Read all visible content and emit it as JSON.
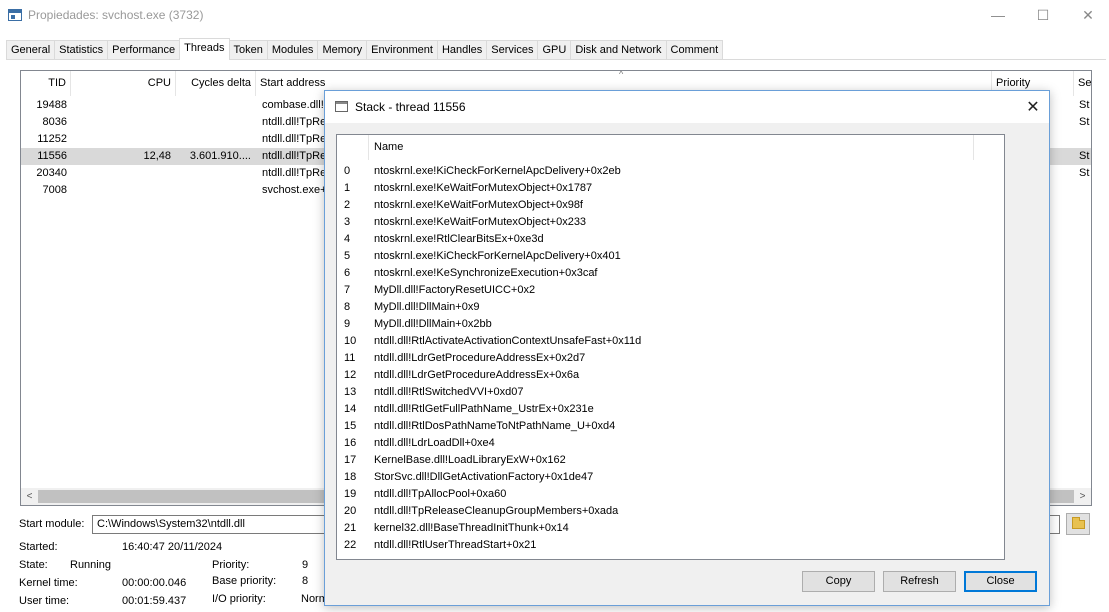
{
  "window": {
    "title": "Propiedades: svchost.exe (3732)",
    "minimize_glyph": "—",
    "maximize_glyph": "☐",
    "close_glyph": "✕"
  },
  "tabs": [
    {
      "label": "General"
    },
    {
      "label": "Statistics"
    },
    {
      "label": "Performance"
    },
    {
      "label": "Threads",
      "active": true
    },
    {
      "label": "Token"
    },
    {
      "label": "Modules"
    },
    {
      "label": "Memory"
    },
    {
      "label": "Environment"
    },
    {
      "label": "Handles"
    },
    {
      "label": "Services"
    },
    {
      "label": "GPU"
    },
    {
      "label": "Disk and Network"
    },
    {
      "label": "Comment"
    }
  ],
  "threads": {
    "sort_glyph": "^",
    "columns": {
      "tid": "TID",
      "cpu": "CPU",
      "cycles": "Cycles delta",
      "start": "Start address",
      "priority": "Priority",
      "se": "Se"
    },
    "rows": [
      {
        "tid": "19488",
        "cpu": "",
        "cycles": "",
        "start": "combase.dll!F",
        "priority": "",
        "se": "St"
      },
      {
        "tid": "8036",
        "cpu": "",
        "cycles": "",
        "start": "ntdll.dll!TpRe",
        "priority": "",
        "se": "St"
      },
      {
        "tid": "11252",
        "cpu": "",
        "cycles": "",
        "start": "ntdll.dll!TpRe",
        "priority": "",
        "se": ""
      },
      {
        "tid": "11556",
        "cpu": "12,48",
        "cycles": "3.601.910....",
        "start": "ntdll.dll!TpRe",
        "priority": "",
        "se": "St"
      },
      {
        "tid": "20340",
        "cpu": "",
        "cycles": "",
        "start": "ntdll.dll!TpRe",
        "priority": "",
        "se": "St"
      },
      {
        "tid": "7008",
        "cpu": "",
        "cycles": "",
        "start": "svchost.exe+",
        "priority": "",
        "se": ""
      }
    ],
    "selected_index": 3,
    "scroll_left": "<",
    "scroll_right": ">"
  },
  "details": {
    "start_module_label": "Start module:",
    "start_module_value": "C:\\Windows\\System32\\ntdll.dll",
    "started_label": "Started:",
    "started_value": "16:40:47 20/11/2024",
    "state_label": "State:",
    "state_value": "Running",
    "priority_label": "Priority:",
    "priority_value": "9",
    "kernel_time_label": "Kernel time:",
    "kernel_time_value": "00:00:00.046",
    "base_priority_label": "Base priority:",
    "base_priority_value": "8",
    "user_time_label": "User time:",
    "user_time_value": "00:01:59.437",
    "io_priority_label": "I/O priority:",
    "io_priority_value": "Norm"
  },
  "stack_dialog": {
    "title": "Stack - thread 11556",
    "close_glyph": "✕",
    "column_name": "Name",
    "frames": [
      {
        "idx": "0",
        "name": "ntoskrnl.exe!KiCheckForKernelApcDelivery+0x2eb"
      },
      {
        "idx": "1",
        "name": "ntoskrnl.exe!KeWaitForMutexObject+0x1787"
      },
      {
        "idx": "2",
        "name": "ntoskrnl.exe!KeWaitForMutexObject+0x98f"
      },
      {
        "idx": "3",
        "name": "ntoskrnl.exe!KeWaitForMutexObject+0x233"
      },
      {
        "idx": "4",
        "name": "ntoskrnl.exe!RtlClearBitsEx+0xe3d"
      },
      {
        "idx": "5",
        "name": "ntoskrnl.exe!KiCheckForKernelApcDelivery+0x401"
      },
      {
        "idx": "6",
        "name": "ntoskrnl.exe!KeSynchronizeExecution+0x3caf"
      },
      {
        "idx": "7",
        "name": "MyDll.dll!FactoryResetUICC+0x2"
      },
      {
        "idx": "8",
        "name": "MyDll.dll!DllMain+0x9"
      },
      {
        "idx": "9",
        "name": "MyDll.dll!DllMain+0x2bb"
      },
      {
        "idx": "10",
        "name": "ntdll.dll!RtlActivateActivationContextUnsafeFast+0x11d"
      },
      {
        "idx": "11",
        "name": "ntdll.dll!LdrGetProcedureAddressEx+0x2d7"
      },
      {
        "idx": "12",
        "name": "ntdll.dll!LdrGetProcedureAddressEx+0x6a"
      },
      {
        "idx": "13",
        "name": "ntdll.dll!RtlSwitchedVVI+0xd07"
      },
      {
        "idx": "14",
        "name": "ntdll.dll!RtlGetFullPathName_UstrEx+0x231e"
      },
      {
        "idx": "15",
        "name": "ntdll.dll!RtlDosPathNameToNtPathName_U+0xd4"
      },
      {
        "idx": "16",
        "name": "ntdll.dll!LdrLoadDll+0xe4"
      },
      {
        "idx": "17",
        "name": "KernelBase.dll!LoadLibraryExW+0x162"
      },
      {
        "idx": "18",
        "name": "StorSvc.dll!DllGetActivationFactory+0x1de47"
      },
      {
        "idx": "19",
        "name": "ntdll.dll!TpAllocPool+0xa60"
      },
      {
        "idx": "20",
        "name": "ntdll.dll!TpReleaseCleanupGroupMembers+0xada"
      },
      {
        "idx": "21",
        "name": "kernel32.dll!BaseThreadInitThunk+0x14"
      },
      {
        "idx": "22",
        "name": "ntdll.dll!RtlUserThreadStart+0x21"
      }
    ],
    "buttons": {
      "copy": "Copy",
      "refresh": "Refresh",
      "close": "Close"
    }
  }
}
